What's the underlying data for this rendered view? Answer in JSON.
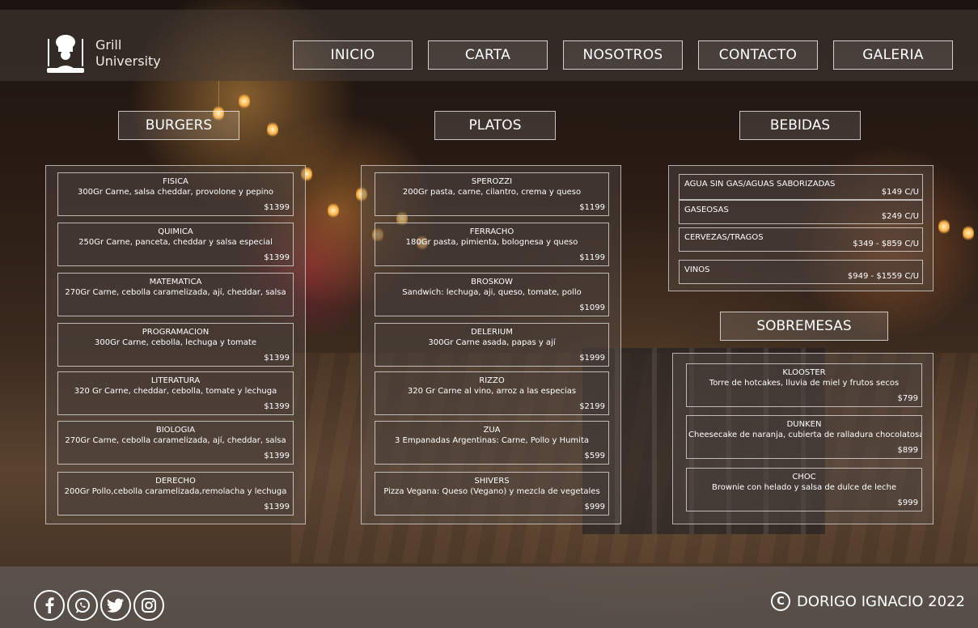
{
  "brand": {
    "line1": "Grill",
    "line2": "University"
  },
  "nav": [
    "INICIO",
    "CARTA",
    "NOSOTROS",
    "CONTACTO",
    "GALERIA"
  ],
  "sections": {
    "burgers": "BURGERS",
    "platos": "PLATOS",
    "bebidas": "BEBIDAS",
    "sobremesas": "SOBREMESAS"
  },
  "burgers": [
    {
      "name": "FISICA",
      "desc": "300Gr Carne, salsa cheddar, provolone y pepino",
      "price": "$1399"
    },
    {
      "name": "QUIMICA",
      "desc": "250Gr Carne, panceta, cheddar y salsa especial",
      "price": "$1399"
    },
    {
      "name": "MATEMATICA",
      "desc": "270Gr Carne, cebolla caramelizada, ají, cheddar, salsa",
      "price": ""
    },
    {
      "name": "PROGRAMACION",
      "desc": "300Gr Carne, cebolla, lechuga y tomate",
      "price": "$1399"
    },
    {
      "name": "LITERATURA",
      "desc": "320 Gr Carne, cheddar, cebolla, tomate y lechuga",
      "price": "$1399"
    },
    {
      "name": "BIOLOGIA",
      "desc": "270Gr Carne, cebolla caramelizada, ají, cheddar, salsa",
      "price": "$1399"
    },
    {
      "name": "DERECHO",
      "desc": "200Gr Pollo,cebolla caramelizada,remolacha y lechuga",
      "price": "$1399"
    }
  ],
  "platos": [
    {
      "name": "SPEROZZI",
      "desc": "200Gr pasta, carne, cilantro, crema y queso",
      "price": "$1199"
    },
    {
      "name": "FERRACHO",
      "desc": "180Gr pasta, pimienta, bolognesa y queso",
      "price": "$1199"
    },
    {
      "name": "BROSKOW",
      "desc": "Sandwich: lechuga, aji, queso, tomate, pollo",
      "price": "$1099"
    },
    {
      "name": "DELERIUM",
      "desc": "300Gr Carne asada, papas y ají",
      "price": "$1999"
    },
    {
      "name": "RIZZO",
      "desc": "320 Gr Carne al vino, arroz a las especias",
      "price": "$2199"
    },
    {
      "name": "ZUA",
      "desc": "3 Empanadas Argentinas: Carne, Pollo y Humita",
      "price": "$599"
    },
    {
      "name": "SHIVERS",
      "desc": "Pizza Vegana: Queso (Vegano) y mezcla de vegetales",
      "price": "$999"
    }
  ],
  "bebidas": [
    {
      "name": "AGUA SIN GAS/AGUAS SABORIZADAS",
      "price": "$149 C/U"
    },
    {
      "name": "GASEOSAS",
      "price": "$249 C/U"
    },
    {
      "name": "CERVEZAS/TRAGOS",
      "price": "$349 - $859 C/U"
    },
    {
      "name": "VINOS",
      "price": "$949 - $1559 C/U"
    }
  ],
  "sobremesas": [
    {
      "name": "KLOOSTER",
      "desc": "Torre de hotcakes, lluvia de miel y frutos secos",
      "price": "$799"
    },
    {
      "name": "DUNKEN",
      "desc": "Cheesecake de naranja, cubierta de ralladura chocolatosa",
      "price": "$899"
    },
    {
      "name": "CHOC",
      "desc": "Brownie con helado y salsa de dulce de leche",
      "price": "$999"
    }
  ],
  "footer": {
    "copyright": "DORIGO IGNACIO 2022"
  },
  "icons": [
    "chef-logo-icon",
    "facebook-icon",
    "whatsapp-icon",
    "twitter-icon",
    "instagram-icon",
    "copyright-icon"
  ]
}
